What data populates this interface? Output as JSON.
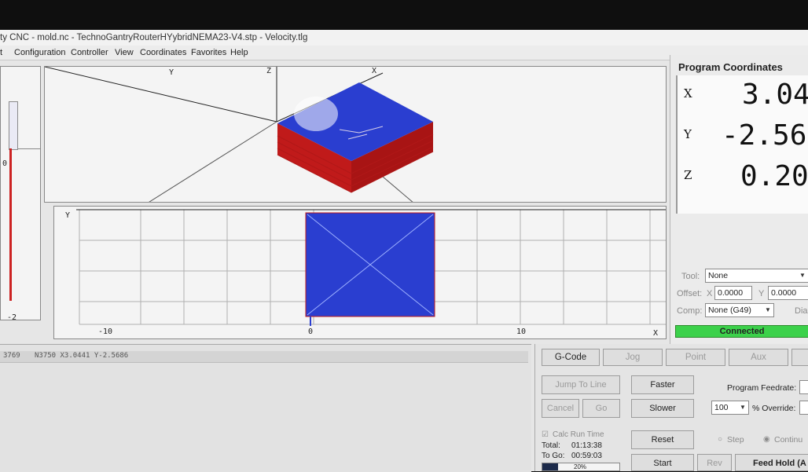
{
  "window": {
    "title": "ty CNC - mold.nc - TechnoGantryRouterHYybridNEMA23-V4.stp - Velocity.tlg"
  },
  "menu": [
    "t",
    "Configuration",
    "Controller",
    "View",
    "Coordinates",
    "Favorites",
    "Help"
  ],
  "left_gauge": {
    "tick_top": "0",
    "tick_bottom": "-2"
  },
  "view3d": {
    "axis_y": "Y",
    "axis_z": "Z",
    "axis_x": "X"
  },
  "view2d": {
    "axis_y": "Y",
    "axis_x": "X",
    "tick_neg10": "-10",
    "tick_0": "0",
    "tick_10": "10"
  },
  "program_coordinates": {
    "title": "Program Coordinates",
    "x_label": "X",
    "x_value": "3.04",
    "y_label": "Y",
    "y_value": "-2.56",
    "z_label": "Z",
    "z_value": "0.20"
  },
  "tool_panel": {
    "tool_label": "Tool:",
    "tool_value": "None",
    "offset_label": "Offset:",
    "offset_x_label": "X",
    "offset_x_value": "0.0000",
    "offset_y_label": "Y",
    "offset_y_value": "0.0000",
    "comp_label": "Comp:",
    "comp_value": "None (G49)",
    "dia_label": "Dia",
    "status": "Connected",
    "status_color": "#3bd14a"
  },
  "gcode_line": {
    "line_no": "3769",
    "text": "N3750 X3.0441 Y-2.5686"
  },
  "tabs": [
    "G-Code",
    "Jog",
    "Point",
    "Aux"
  ],
  "controls": {
    "jump_to_line": "Jump To Line",
    "cancel": "Cancel",
    "go": "Go",
    "faster": "Faster",
    "slower": "Slower",
    "program_feedrate_label": "Program Feedrate:",
    "override_value": "100",
    "override_label": "% Override:",
    "calc_run_time": "Calc Run Time",
    "total_label": "Total:",
    "total_value": "01:13:38",
    "to_go_label": "To Go:",
    "to_go_value": "00:59:03",
    "progress_label": "20%",
    "progress": 0.2,
    "reset": "Reset",
    "start": "Start",
    "rev": "Rev",
    "feed_hold": "Feed Hold (A",
    "step": "Step",
    "continuous": "Continu"
  }
}
